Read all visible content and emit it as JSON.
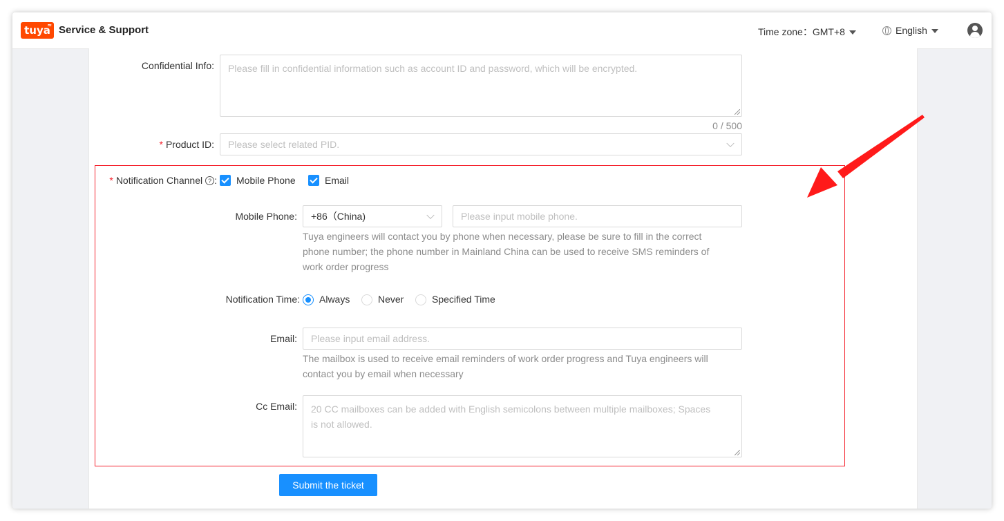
{
  "header": {
    "logo_text": "tuya",
    "brand": "Service & Support",
    "timezone_label": "Time zone：GMT+8",
    "language": "English"
  },
  "form": {
    "confidential": {
      "label": "Confidential Info",
      "placeholder": "Please fill in confidential information such as account ID and password, which will be encrypted.",
      "counter": "0 / 500"
    },
    "product_id": {
      "label": "Product ID",
      "placeholder": "Please select related PID."
    },
    "notification_channel": {
      "label": "Notification Channel",
      "options": [
        {
          "label": "Mobile Phone",
          "checked": true
        },
        {
          "label": "Email",
          "checked": true
        }
      ]
    },
    "mobile_phone": {
      "label": "Mobile Phone",
      "country_code": "+86（China)",
      "placeholder": "Please input mobile phone.",
      "hint": [
        "Tuya engineers will contact you by phone when necessary, please be sure to fill in the correct",
        "phone number; the phone number in Mainland China can be used to receive SMS reminders of",
        "work order progress"
      ]
    },
    "notification_time": {
      "label": "Notification Time",
      "options": [
        {
          "label": "Always",
          "selected": true
        },
        {
          "label": "Never",
          "selected": false
        },
        {
          "label": "Specified Time",
          "selected": false
        }
      ]
    },
    "email": {
      "label": "Email",
      "placeholder": "Please input email address.",
      "hint": [
        "The mailbox is used to receive email reminders of work order progress and Tuya engineers will",
        "contact you by email when necessary"
      ]
    },
    "cc_email": {
      "label": "Cc Email",
      "placeholder_lines": [
        "20 CC mailboxes can be added with English semicolons between multiple mailboxes;  Spaces",
        "is not allowed."
      ]
    },
    "submit_label": "Submit the ticket"
  },
  "colors": {
    "accent": "#1890ff",
    "highlight": "#f5222d",
    "arrow": "#ff1a1a",
    "brand": "#ff4800"
  }
}
